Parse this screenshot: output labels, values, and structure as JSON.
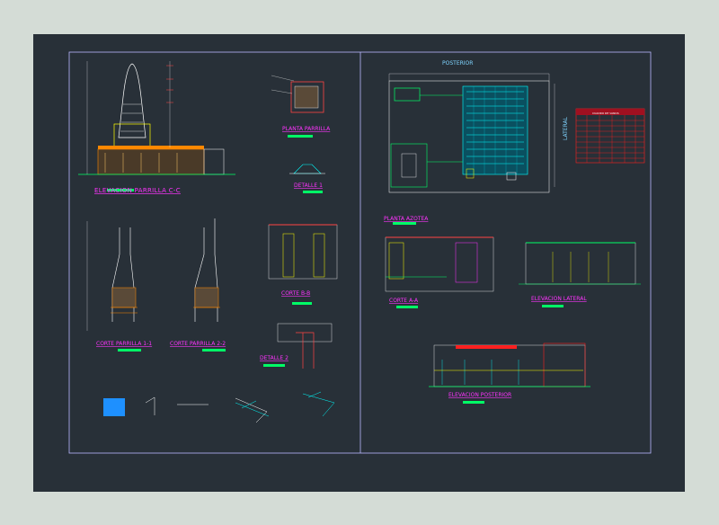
{
  "labels": {
    "elev_parrilla": "ELEVACION PARRILLA C-C",
    "planta_parrilla": "PLANTA PARRILLA",
    "detalle_1": "DETALLE 1",
    "corte_parrilla_1": "CORTE PARRILLA 1-1",
    "corte_parrilla_2": "CORTE PARRILLA 2-2",
    "corte_b": "CORTE B-B",
    "detalle_2": "DETALLE 2",
    "planta_azotea": "PLANTA AZOTEA",
    "corte_a": "CORTE A-A",
    "elev_lateral": "ELEVACION LATERAL",
    "elev_posterior": "ELEVACION POSTERIOR",
    "posterior": "POSTERIOR",
    "lateral": "LATERAL",
    "cuadro_vanos": "CUADRO DE VANOS"
  },
  "colors": {
    "background": "#283038",
    "frame": "#b8b8ff",
    "label": "#ff33ff",
    "accent_green": "#00ff66",
    "accent_cyan": "#00ffff",
    "accent_yellow": "#ffff00",
    "accent_red": "#ff2020"
  }
}
